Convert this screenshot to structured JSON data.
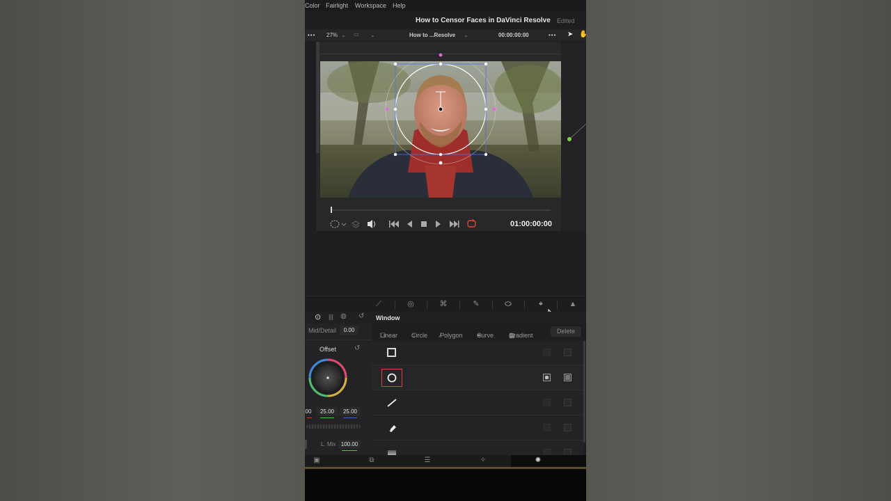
{
  "menu": [
    "Color",
    "Fairlight",
    "Workspace",
    "Help"
  ],
  "project": {
    "title": "How to Censor Faces in DaVinci Resolve",
    "status": "Edited"
  },
  "viewer_toolbar": {
    "zoom": "27%",
    "clip_name": "How to ...Resolve",
    "timecode": "00:00:00:00"
  },
  "transport": {
    "timecode": "01:00:00:00"
  },
  "window_panel": {
    "title": "Window",
    "tools": [
      "Linear",
      "Circle",
      "Polygon",
      "Curve",
      "Gradient"
    ],
    "delete_label": "Delete",
    "shapes": [
      {
        "icon": "square-window-icon",
        "selected": false,
        "enabled": false
      },
      {
        "icon": "circle-window-icon",
        "selected": true,
        "enabled": true
      },
      {
        "icon": "linear-window-icon",
        "selected": false,
        "enabled": false
      },
      {
        "icon": "pen-curve-window-icon",
        "selected": false,
        "enabled": false
      },
      {
        "icon": "gradient-window-icon",
        "selected": false,
        "enabled": false
      }
    ]
  },
  "left_panel": {
    "mid_detail_label": "Mid/Detail",
    "mid_detail_value": "0.00",
    "offset_label": "Offset",
    "values": [
      "00",
      "25.00",
      "25.00"
    ],
    "lum_mix_label": "L. Mix",
    "lum_mix_value": "100.00"
  },
  "colors": {
    "accent_selected": "#d9473a",
    "loop_icon": "#e0453a",
    "node_green": "#7fd63a",
    "window_overlay": "#ffffff",
    "softness_handles": "#e36bd6"
  }
}
